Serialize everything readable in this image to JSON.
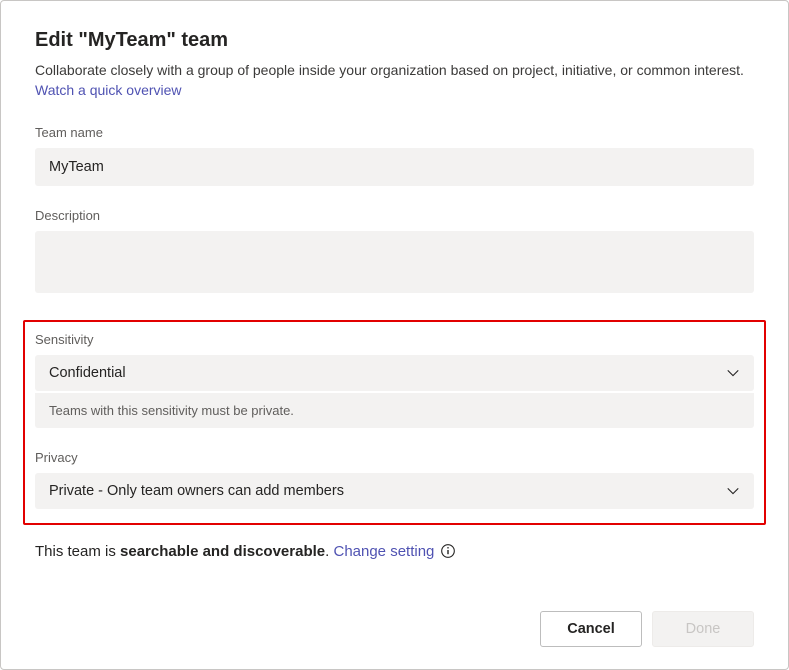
{
  "header": {
    "title": "Edit \"MyTeam\" team",
    "subtitle_pre": "Collaborate closely with a group of people inside your organization based on project, initiative, or common interest. ",
    "overview_link": "Watch a quick overview"
  },
  "team_name": {
    "label": "Team name",
    "value": "MyTeam"
  },
  "description": {
    "label": "Description",
    "value": ""
  },
  "sensitivity": {
    "label": "Sensitivity",
    "value": "Confidential",
    "helper": "Teams with this sensitivity must be private."
  },
  "privacy": {
    "label": "Privacy",
    "value": "Private - Only team owners can add members"
  },
  "search_status": {
    "prefix": "This team is ",
    "bold": "searchable and discoverable",
    "suffix": ". ",
    "change_link": "Change setting"
  },
  "footer": {
    "cancel": "Cancel",
    "done": "Done"
  }
}
